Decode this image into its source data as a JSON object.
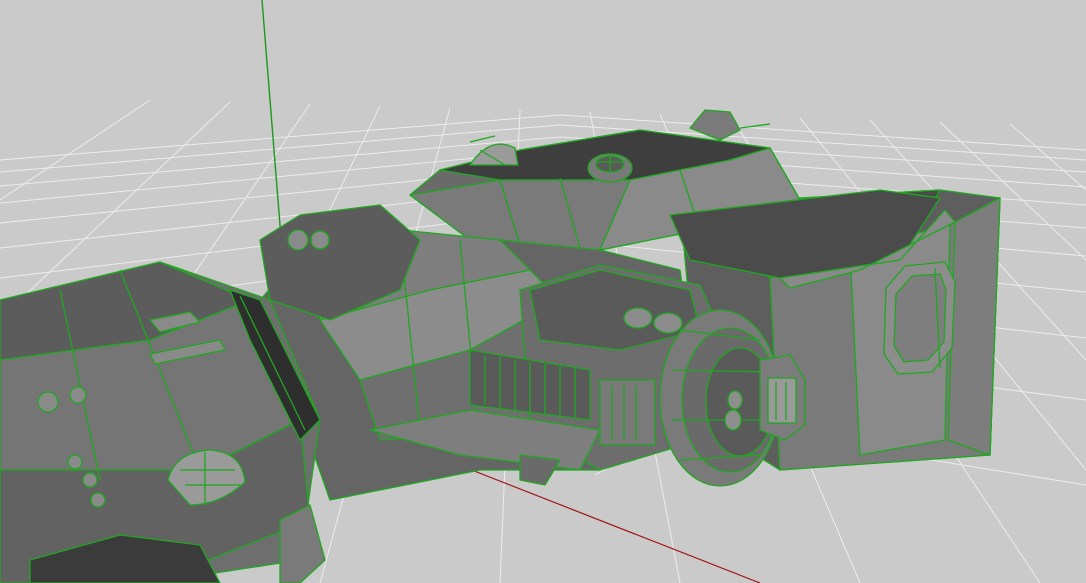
{
  "viewport": {
    "view": "perspective",
    "background_color": "#cacaca",
    "grid_color": "#ececec",
    "wireframe_color": "#1fa81f",
    "y_axis_color": "#1a9a1a",
    "x_axis_color": "#a11515",
    "z_axis_color": "#e8e8e8",
    "grid_visible": true,
    "shading_mode": "wireframe-on-shaded"
  },
  "model": {
    "type": "spaceship-mesh",
    "selected": true,
    "surface_color": "#6f6f6f",
    "surface_dark_color": "#3f3f3f",
    "surface_light_color": "#9a9a9a"
  }
}
